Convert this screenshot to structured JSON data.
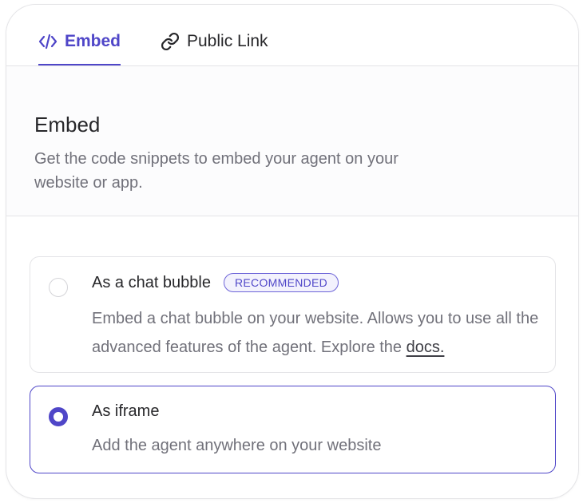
{
  "tabs": [
    {
      "label": "Embed",
      "icon": "code-icon",
      "active": true
    },
    {
      "label": "Public Link",
      "icon": "link-icon",
      "active": false
    }
  ],
  "section": {
    "title": "Embed",
    "subtitle": "Get the code snippets to embed your agent on your website or app."
  },
  "options": [
    {
      "title": "As a chat bubble",
      "badge": "RECOMMENDED",
      "description": "Embed a chat bubble on your website. Allows you to use all the advanced features of the agent. Explore the ",
      "link_text": "docs.",
      "selected": false
    },
    {
      "title": "As iframe",
      "description": "Add the agent anywhere on your website",
      "selected": true
    }
  ],
  "colors": {
    "accent": "#4f46c8",
    "border": "#e4e4e7",
    "text": "#27272a",
    "muted": "#71717a"
  }
}
